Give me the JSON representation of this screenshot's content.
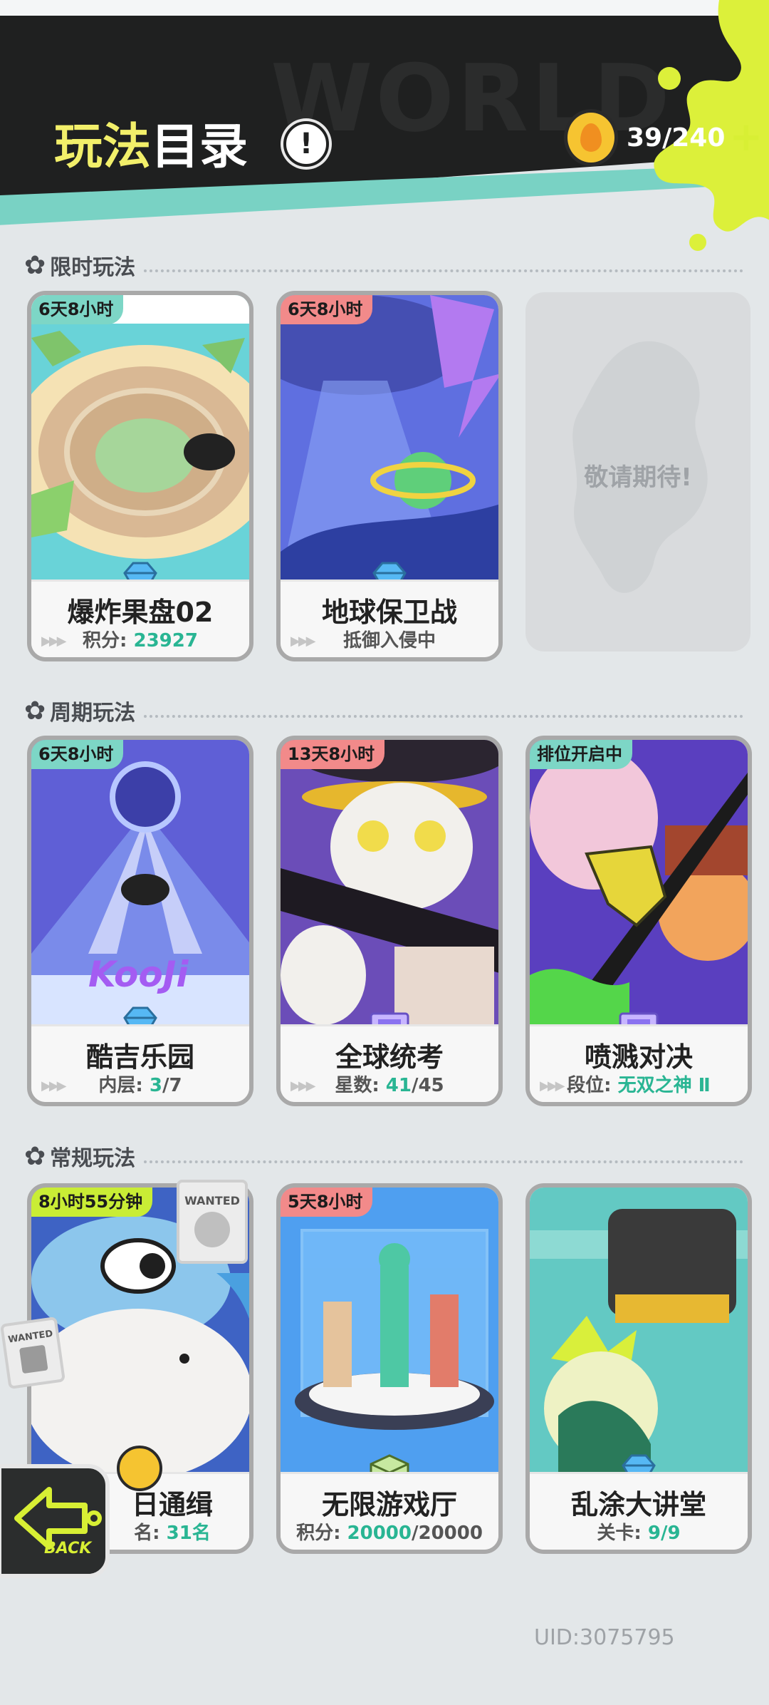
{
  "header": {
    "title_part1": "玩法",
    "title_part2": "目录",
    "info_icon": "!",
    "bg_text": "WORLD",
    "currency_value": "39/240",
    "currency_plus": "+"
  },
  "sections": {
    "limited": "限时玩法",
    "periodic": "周期玩法",
    "regular": "常规玩法"
  },
  "cards": {
    "c1": {
      "tag": "6天8小时",
      "title": "爆炸果盘02",
      "sub_label": "积分: ",
      "sub_value": "23927"
    },
    "c2": {
      "tag": "6天8小时",
      "title": "地球保卫战",
      "sub_text": "抵御入侵中"
    },
    "c3": {
      "placeholder": "敬请期待!"
    },
    "c4": {
      "tag": "6天8小时",
      "title": "酷吉乐园",
      "sub_label": "内层: ",
      "sub_value": "3",
      "sub_max": "/7",
      "art_text": "KooJi"
    },
    "c5": {
      "tag": "13天8小时",
      "title": "全球统考",
      "sub_label": "星数: ",
      "sub_value": "41",
      "sub_max": "/45"
    },
    "c6": {
      "tag": "排位开启中",
      "title": "喷溅对决",
      "sub_label": "段位: ",
      "sub_value": "无双之神 Ⅱ"
    },
    "c7": {
      "tag": "8小时55分钟",
      "title": "日通缉",
      "sub_label": "名: ",
      "sub_value": "31名",
      "wanted": "WANTED"
    },
    "c8": {
      "tag": "5天8小时",
      "title": "无限游戏厅",
      "sub_label": "积分: ",
      "sub_value": "20000",
      "sub_max": "/20000"
    },
    "c9": {
      "title": "乱涂大讲堂",
      "sub_label": "关卡: ",
      "sub_value": "9/9"
    }
  },
  "back_button": "BACK",
  "uid": "UID:3075795",
  "colors": {
    "accent_lime": "#d8ef34",
    "accent_teal": "#79d2c4",
    "value_green": "#29b593",
    "header_dark": "#1f2020"
  }
}
